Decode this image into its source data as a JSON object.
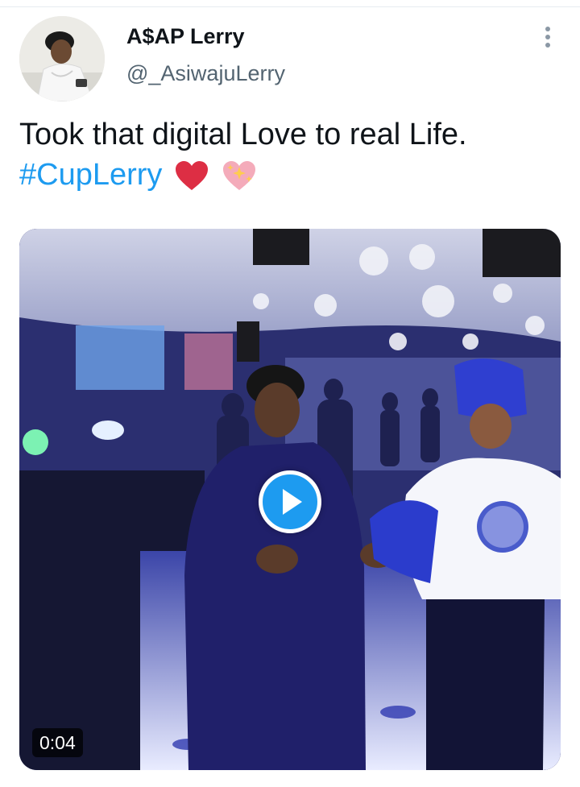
{
  "tweet": {
    "author_name": "A$AP Lerry",
    "author_handle": "@_AsiwajuLerry",
    "text_line1": "Took that digital Love to real Life.",
    "hashtag": "#CupLerry",
    "emojis": [
      "red-heart",
      "sparkling-heart"
    ]
  },
  "video": {
    "duration": "0:04",
    "play_icon": "play-icon"
  },
  "colors": {
    "link": "#1d9bf0",
    "handle_gray": "#536471",
    "text": "#0f1419"
  }
}
